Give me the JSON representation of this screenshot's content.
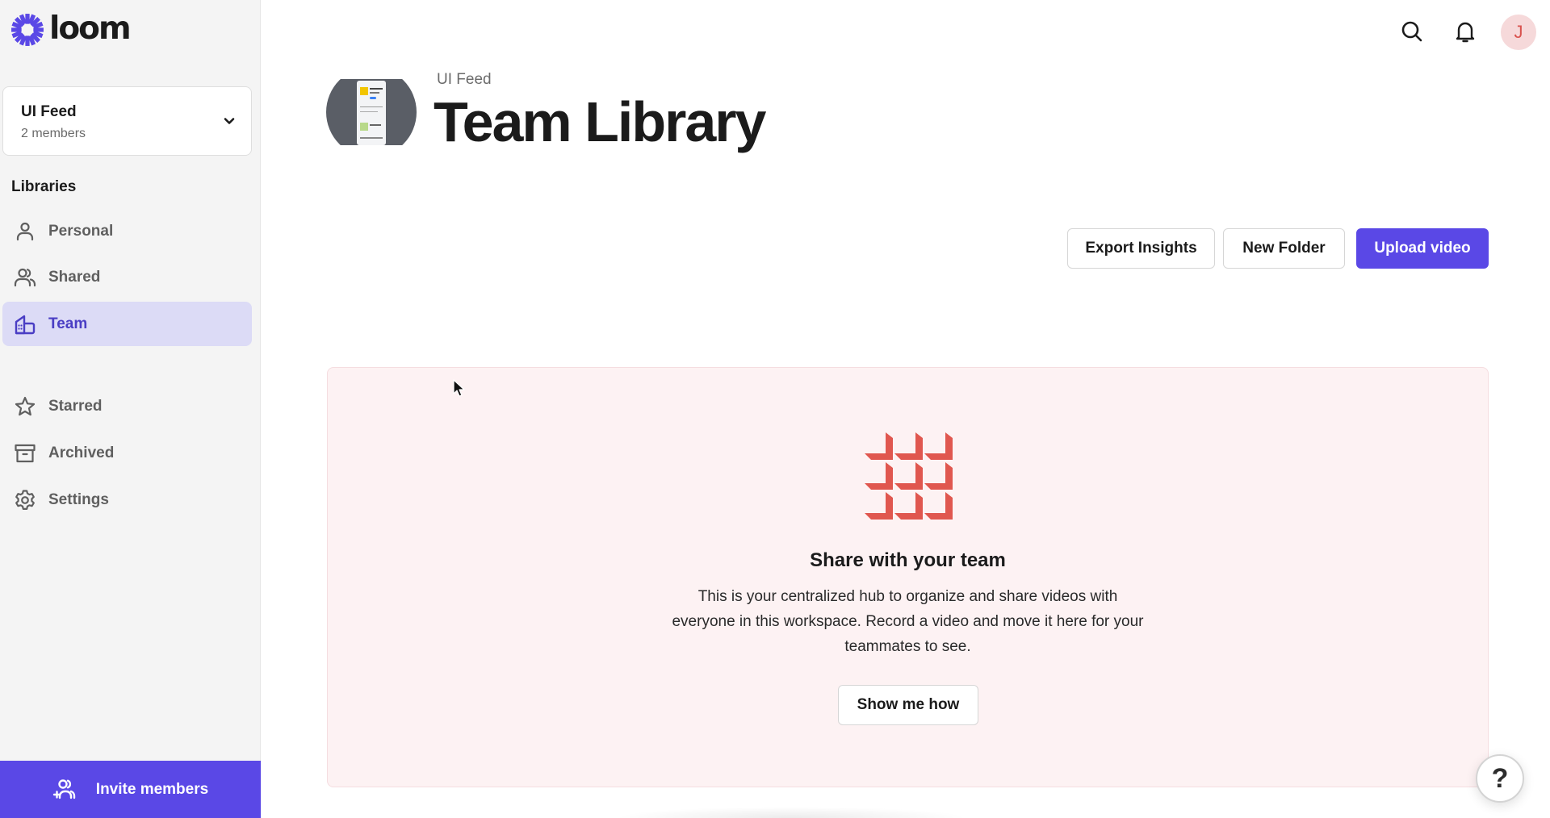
{
  "app": {
    "logo_text": "loom",
    "brand_color": "#5a48e6"
  },
  "sidebar": {
    "workspace": {
      "name": "UI Feed",
      "members": "2 members"
    },
    "section_label": "Libraries",
    "items": [
      {
        "label": "Personal",
        "icon": "person-icon",
        "active": false
      },
      {
        "label": "Shared",
        "icon": "people-icon",
        "active": false
      },
      {
        "label": "Team",
        "icon": "building-icon",
        "active": true
      },
      {
        "label": "Starred",
        "icon": "star-icon",
        "active": false
      },
      {
        "label": "Archived",
        "icon": "archive-icon",
        "active": false
      },
      {
        "label": "Settings",
        "icon": "gear-icon",
        "active": false
      }
    ],
    "invite_label": "Invite members"
  },
  "topbar": {
    "user_initial": "J"
  },
  "header": {
    "breadcrumb": "UI Feed",
    "title": "Team Library"
  },
  "toolbar": {
    "export_label": "Export Insights",
    "new_folder_label": "New Folder",
    "upload_label": "Upload video"
  },
  "empty_state": {
    "title": "Share with your team",
    "body": "This is your centralized hub to organize and share videos with everyone in this workspace. Record a video and move it here for your teammates to see.",
    "button_label": "Show me how",
    "icon_color": "#e0574f"
  },
  "help": {
    "label": "?"
  }
}
